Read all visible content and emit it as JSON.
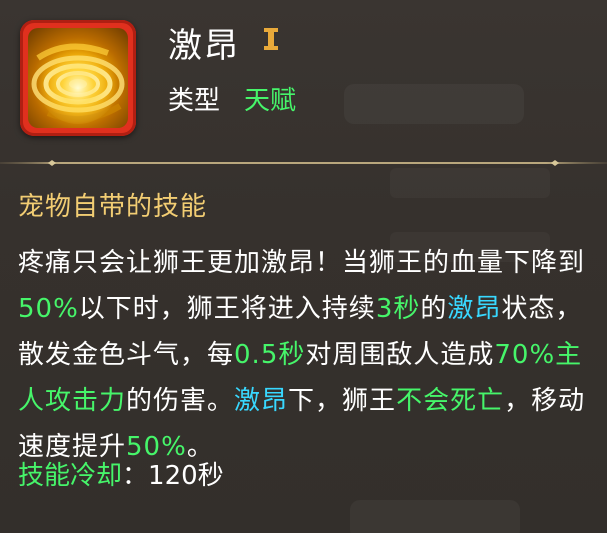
{
  "skill": {
    "name": "激昂",
    "tier": "I",
    "type_label": "类型",
    "type_value": "天赋",
    "icon": "golden-swirl-icon"
  },
  "section": {
    "title": "宠物自带的技能"
  },
  "description": {
    "segments": [
      {
        "text": "疼痛只会让狮王更加激昂！当狮王的血量下降到",
        "color": "white"
      },
      {
        "text": "50%",
        "color": "green"
      },
      {
        "text": "以下时，狮王将进入持续",
        "color": "white"
      },
      {
        "text": "3秒",
        "color": "green"
      },
      {
        "text": "的",
        "color": "white"
      },
      {
        "text": "激昂",
        "color": "cyan"
      },
      {
        "text": "状态，散发金色斗气，每",
        "color": "white"
      },
      {
        "text": "0.5秒",
        "color": "green"
      },
      {
        "text": "对周围敌人造成",
        "color": "white"
      },
      {
        "text": "70%主人攻击力",
        "color": "green"
      },
      {
        "text": "的伤害。",
        "color": "white"
      },
      {
        "text": "激昂",
        "color": "cyan"
      },
      {
        "text": "下，狮王",
        "color": "white"
      },
      {
        "text": "不会死亡",
        "color": "green"
      },
      {
        "text": "，移动速度提升",
        "color": "white"
      },
      {
        "text": "50%",
        "color": "green"
      },
      {
        "text": "。",
        "color": "white"
      }
    ]
  },
  "cooldown": {
    "label": "技能冷却",
    "colon": "：",
    "value": "120秒"
  },
  "colors": {
    "green": "#46f56a",
    "cyan": "#38d8ff",
    "gold": "#f2cd73",
    "white": "#ffffff"
  }
}
